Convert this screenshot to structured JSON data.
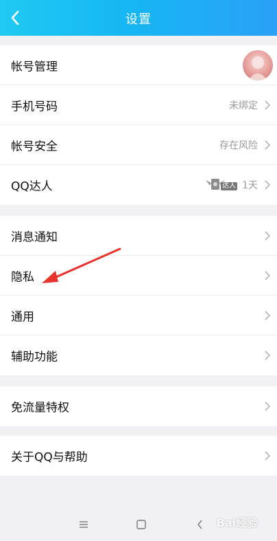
{
  "header": {
    "title": "设置"
  },
  "sections": [
    {
      "items": [
        {
          "label": "帐号管理",
          "value": ""
        },
        {
          "label": "手机号码",
          "value": "未绑定"
        },
        {
          "label": "帐号安全",
          "value": "存在风险"
        },
        {
          "label": "QQ达人",
          "value": "1天",
          "badge_text": "达人"
        }
      ]
    },
    {
      "items": [
        {
          "label": "消息通知"
        },
        {
          "label": "隐私"
        },
        {
          "label": "通用"
        },
        {
          "label": "辅助功能"
        }
      ]
    },
    {
      "items": [
        {
          "label": "免流量特权"
        }
      ]
    },
    {
      "items": [
        {
          "label": "关于QQ与帮助"
        }
      ]
    }
  ],
  "watermark": "Bai经验",
  "colors": {
    "header_start": "#20c9f2",
    "header_end": "#2aa0f7",
    "arrow": "#e8322b",
    "background": "#f0f0f5"
  }
}
